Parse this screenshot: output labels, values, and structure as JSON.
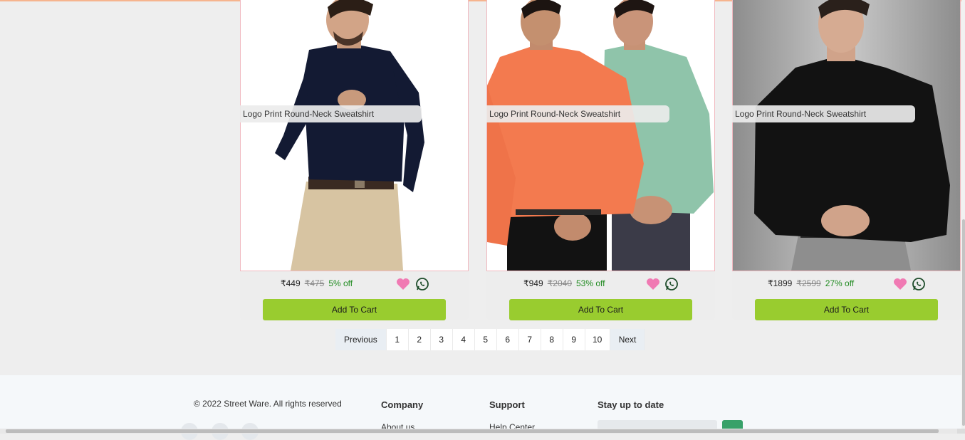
{
  "products": [
    {
      "title": "Logo Print Round-Neck Sweatshirt",
      "price": "₹449",
      "mrp": "₹475",
      "discount": "5% off",
      "cart_label": "Add To Cart",
      "image": "man-navy-shirt-beige-trousers"
    },
    {
      "title": "Logo Print Round-Neck Sweatshirt",
      "price": "₹949",
      "mrp": "₹2040",
      "discount": "53% off",
      "cart_label": "Add To Cart",
      "image": "two-men-orange-and-mint-shirts"
    },
    {
      "title": "Logo Print Round-Neck Sweatshirt",
      "price": "₹1899",
      "mrp": "₹2599",
      "discount": "27% off",
      "cart_label": "Add To Cart",
      "image": "man-black-shirt-grey-trousers"
    }
  ],
  "pagination": {
    "previous": "Previous",
    "next": "Next",
    "pages": [
      "1",
      "2",
      "3",
      "4",
      "5",
      "6",
      "7",
      "8",
      "9",
      "10"
    ]
  },
  "footer": {
    "copyright": "© 2022 Street Ware. All rights reserved",
    "company": {
      "heading": "Company",
      "first_link": "About us"
    },
    "support": {
      "heading": "Support",
      "first_link": "Help Center"
    },
    "newsletter": {
      "heading": "Stay up to date"
    }
  },
  "icons": {
    "wishlist": "heart-icon",
    "share": "whatsapp-icon"
  },
  "colors": {
    "accent_green": "#99cc2f",
    "heart_pink": "#f07ab3",
    "discount_green": "#1f8a1f"
  }
}
